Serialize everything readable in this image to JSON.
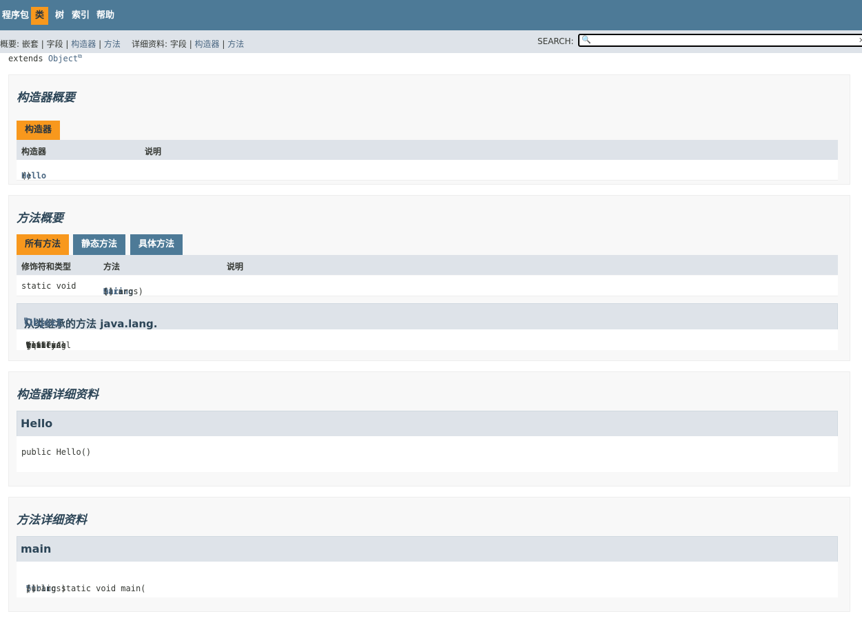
{
  "topnav": {
    "items": [
      "程序包",
      "类",
      "树",
      "索引",
      "帮助"
    ]
  },
  "subnav": {
    "summary_prefix": "概要: ",
    "summary_items": [
      "嵌套",
      "字段",
      "构造器",
      "方法"
    ],
    "detail_prefix": "详细资料: ",
    "detail_items": [
      "字段",
      "构造器",
      "方法"
    ],
    "separator": " | ",
    "search_label": "SEARCH:",
    "search_value": ""
  },
  "header": {
    "extends_kw": "extends",
    "extends_class": "Object"
  },
  "constructor_summary": {
    "title": "构造器概要",
    "tab": "构造器",
    "col_headers": [
      "构造器",
      "说明"
    ],
    "rows": [
      {
        "name": "Hello",
        "params": "()",
        "desc": ""
      }
    ]
  },
  "method_summary": {
    "title": "方法概要",
    "tabs": [
      "所有方法",
      "静态方法",
      "具体方法"
    ],
    "col_headers": [
      "修饰符和类型",
      "方法",
      "说明"
    ],
    "rows": [
      {
        "modifier": "static void",
        "name": "main",
        "open": "(",
        "param_type": "String",
        "param_rest": "[]  args)",
        "desc": ""
      }
    ],
    "inherited": {
      "heading_prefix": "从类继承的方法 java.lang.",
      "heading_class": "Object",
      "methods": [
        "clone",
        "equals",
        "finalize",
        "getClass",
        "hashCode",
        "notify",
        "notifyAll",
        "toString",
        "wait",
        "wait",
        "wait"
      ]
    }
  },
  "constructor_detail": {
    "title": "构造器详细资料",
    "heading": "Hello",
    "signature": "public  Hello()"
  },
  "method_detail": {
    "title": "方法详细资料",
    "heading": "main",
    "sig_prefix": "public static  void  main(",
    "sig_type": "String",
    "sig_suffix": "[]  args)"
  },
  "colors": {
    "nav_bg": "#4d7a97",
    "active_tab": "#f8981d",
    "subnav_bg": "#dee3e9",
    "link": "#4a6782"
  }
}
